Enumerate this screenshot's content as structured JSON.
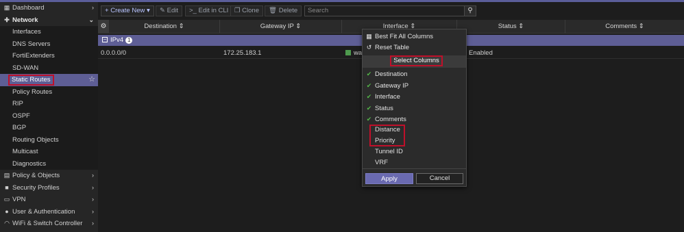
{
  "sidebar": {
    "dashboard": "Dashboard",
    "network": "Network",
    "items": [
      "Interfaces",
      "DNS Servers",
      "FortiExtenders",
      "SD-WAN",
      "Static Routes",
      "Policy Routes",
      "RIP",
      "OSPF",
      "BGP",
      "Routing Objects",
      "Multicast",
      "Diagnostics"
    ],
    "bottom": [
      "Policy & Objects",
      "Security Profiles",
      "VPN",
      "User & Authentication",
      "WiFi & Switch Controller"
    ]
  },
  "toolbar": {
    "create_new": "Create New",
    "edit": "Edit",
    "edit_cli": "Edit in CLI",
    "clone": "Clone",
    "delete": "Delete",
    "search_placeholder": "Search"
  },
  "table": {
    "columns": [
      "Destination",
      "Gateway IP",
      "Interface",
      "Status",
      "Comments"
    ],
    "group": {
      "label": "IPv4",
      "count": "1"
    },
    "rows": [
      {
        "destination": "0.0.0.0/0",
        "gateway": "172.25.183.1",
        "interface": "wa",
        "status": "Enabled",
        "comments": ""
      }
    ]
  },
  "menu": {
    "best_fit": "Best Fit All Columns",
    "reset": "Reset Table",
    "select_columns": "Select Columns",
    "checked": [
      "Destination",
      "Gateway IP",
      "Interface",
      "Status",
      "Comments"
    ],
    "unchecked": [
      "Distance",
      "Priority",
      "Tunnel ID",
      "VRF"
    ],
    "apply": "Apply",
    "cancel": "Cancel"
  },
  "colors": {
    "accent": "#5e5e95",
    "highlight": "#c0102a",
    "check": "#54b848"
  }
}
